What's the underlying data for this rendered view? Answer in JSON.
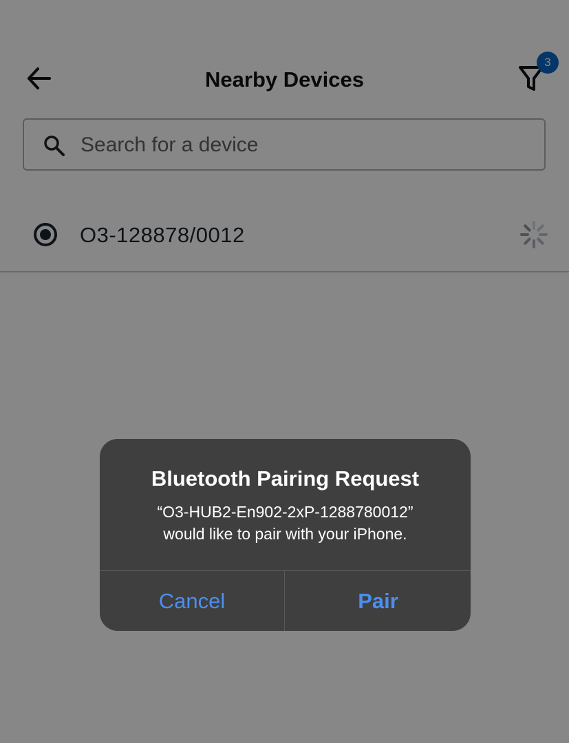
{
  "header": {
    "title": "Nearby Devices",
    "filter_badge_count": "3",
    "back_icon": "arrow-left-icon",
    "filter_icon": "funnel-filter-icon"
  },
  "search": {
    "placeholder": "Search for a device",
    "value": "",
    "icon": "search-icon"
  },
  "devices": [
    {
      "name": "O3-128878/0012",
      "selected": true,
      "status": "connecting"
    }
  ],
  "dialog": {
    "title": "Bluetooth Pairing Request",
    "message_line1": "“O3-HUB2-En902-2xP-1288780012”",
    "message_line2": "would like to pair with your iPhone.",
    "cancel_label": "Cancel",
    "confirm_label": "Pair"
  },
  "colors": {
    "accent": "#4a8ff0",
    "badge": "#0a66c2",
    "dialog_background": "#3f3f3f",
    "overlay": "rgba(0,0,0,0.47)"
  }
}
